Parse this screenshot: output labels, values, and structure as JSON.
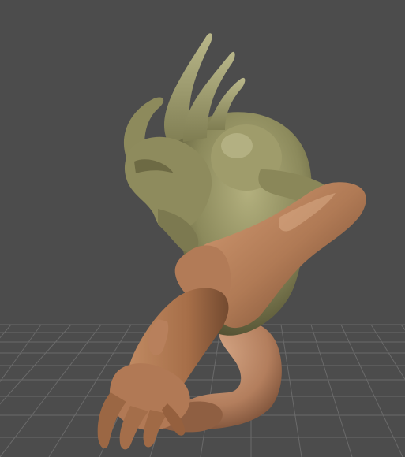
{
  "viewport": {
    "background_color": "#4c4c4c",
    "grid": {
      "visible": true,
      "line_color": "#6a6a6a"
    },
    "model": {
      "icon": "creature-model-icon",
      "body_skin_color": "#8c8a5c",
      "arm_skin_color": "#b07a55"
    }
  }
}
